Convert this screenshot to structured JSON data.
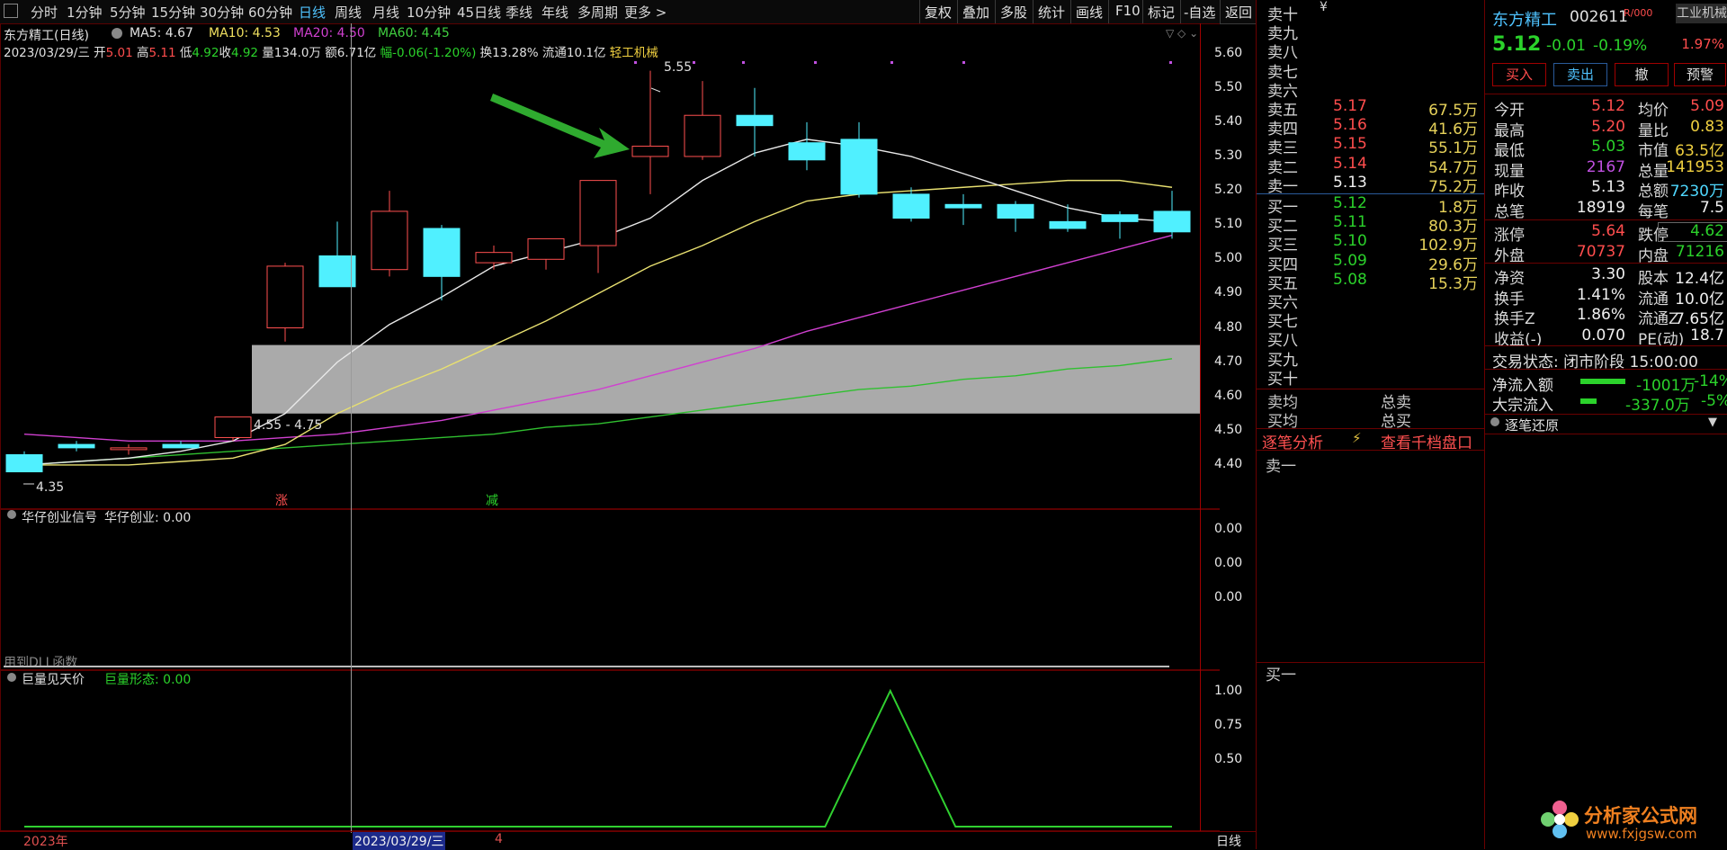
{
  "toolbar": {
    "periods": [
      "分时",
      "1分钟",
      "5分钟",
      "15分钟",
      "30分钟",
      "60分钟",
      "日线",
      "周线",
      "月线",
      "10分钟",
      "45日线",
      "季线",
      "年线",
      "多周期",
      "更多 >"
    ],
    "active_period": "日线",
    "right_buttons": [
      "复权",
      "叠加",
      "多股",
      "统计",
      "画线",
      "F10",
      "标记",
      "-自选",
      "返回"
    ]
  },
  "main_chart": {
    "title": "东方精工(日线)",
    "ma_legend": [
      {
        "label": "MA5: 4.67",
        "color": "#e0e0e0"
      },
      {
        "label": "MA10: 4.53",
        "color": "#f0e060"
      },
      {
        "label": "MA20: 4.50",
        "color": "#d040d0"
      },
      {
        "label": "MA60: 4.45",
        "color": "#40d040"
      }
    ],
    "info": {
      "date": "2023/03/29/三",
      "open_label": "开",
      "open": "5.01",
      "high_label": "高",
      "high": "5.11",
      "low_label": "低",
      "low": "4.92",
      "close_label": "收",
      "close": "4.92",
      "volume": "量134.0万",
      "amount": "额6.71亿",
      "change": "幅-0.06(-1.20%)",
      "turnover": "换13.28%",
      "float": "流通10.1亿",
      "industry": "轻工机械"
    },
    "y_ticks": [
      "5.60",
      "5.50",
      "5.40",
      "5.30",
      "5.20",
      "5.10",
      "5.00",
      "4.90",
      "4.80",
      "4.70",
      "4.60",
      "4.50",
      "4.40"
    ],
    "zone_label": "4.55 - 4.75",
    "high_mark": "5.55",
    "low_mark": "4.35",
    "marker_up": "涨",
    "marker_down": "减"
  },
  "chart_data": {
    "type": "candlestick",
    "ylim": [
      4.35,
      5.62
    ],
    "candles": [
      {
        "o": 4.43,
        "h": 4.44,
        "l": 4.38,
        "c": 4.38
      },
      {
        "o": 4.46,
        "h": 4.47,
        "l": 4.44,
        "c": 4.45
      },
      {
        "o": 4.45,
        "h": 4.46,
        "l": 4.43,
        "c": 4.45
      },
      {
        "o": 4.46,
        "h": 4.47,
        "l": 4.45,
        "c": 4.45
      },
      {
        "o": 4.48,
        "h": 4.52,
        "l": 4.47,
        "c": 4.54
      },
      {
        "o": 4.8,
        "h": 4.99,
        "l": 4.76,
        "c": 4.98
      },
      {
        "o": 5.01,
        "h": 5.11,
        "l": 4.92,
        "c": 4.92
      },
      {
        "o": 4.97,
        "h": 5.2,
        "l": 4.95,
        "c": 5.14
      },
      {
        "o": 5.09,
        "h": 5.1,
        "l": 4.88,
        "c": 4.95
      },
      {
        "o": 4.99,
        "h": 5.04,
        "l": 4.97,
        "c": 5.02
      },
      {
        "o": 5.0,
        "h": 5.06,
        "l": 4.97,
        "c": 5.06
      },
      {
        "o": 5.04,
        "h": 5.23,
        "l": 4.96,
        "c": 5.23
      },
      {
        "o": 5.3,
        "h": 5.55,
        "l": 5.19,
        "c": 5.33
      },
      {
        "o": 5.3,
        "h": 5.52,
        "l": 5.29,
        "c": 5.42
      },
      {
        "o": 5.42,
        "h": 5.5,
        "l": 5.3,
        "c": 5.39
      },
      {
        "o": 5.34,
        "h": 5.4,
        "l": 5.26,
        "c": 5.29
      },
      {
        "o": 5.35,
        "h": 5.4,
        "l": 5.18,
        "c": 5.19
      },
      {
        "o": 5.19,
        "h": 5.21,
        "l": 5.11,
        "c": 5.12
      },
      {
        "o": 5.16,
        "h": 5.19,
        "l": 5.1,
        "c": 5.15
      },
      {
        "o": 5.16,
        "h": 5.17,
        "l": 5.08,
        "c": 5.12
      },
      {
        "o": 5.11,
        "h": 5.16,
        "l": 5.08,
        "c": 5.09
      },
      {
        "o": 5.13,
        "h": 5.14,
        "l": 5.06,
        "c": 5.11
      },
      {
        "o": 5.14,
        "h": 5.2,
        "l": 5.06,
        "c": 5.08
      }
    ],
    "ma5": [
      4.4,
      4.41,
      4.42,
      4.44,
      4.47,
      4.55,
      4.7,
      4.81,
      4.89,
      4.98,
      5.02,
      5.06,
      5.12,
      5.23,
      5.31,
      5.35,
      5.33,
      5.3,
      5.25,
      5.2,
      5.15,
      5.12,
      5.11
    ],
    "ma10": [
      4.4,
      4.4,
      4.4,
      4.41,
      4.42,
      4.46,
      4.55,
      4.62,
      4.68,
      4.75,
      4.82,
      4.9,
      4.98,
      5.04,
      5.11,
      5.17,
      5.19,
      5.2,
      5.21,
      5.22,
      5.23,
      5.23,
      5.21
    ],
    "ma20": [
      4.49,
      4.48,
      4.47,
      4.47,
      4.47,
      4.48,
      4.49,
      4.51,
      4.53,
      4.56,
      4.59,
      4.62,
      4.66,
      4.7,
      4.74,
      4.79,
      4.83,
      4.87,
      4.91,
      4.95,
      4.99,
      5.03,
      5.07
    ],
    "ma60": [
      4.4,
      4.41,
      4.42,
      4.43,
      4.44,
      4.45,
      4.46,
      4.47,
      4.48,
      4.49,
      4.51,
      4.52,
      4.54,
      4.56,
      4.58,
      4.6,
      4.62,
      4.63,
      4.65,
      4.66,
      4.68,
      4.69,
      4.71
    ],
    "support_zone": [
      4.55,
      4.75
    ]
  },
  "ind1": {
    "title": "华仔创业信号",
    "value_label": "华仔创业: 0.00",
    "y_ticks": [
      "0.00",
      "0.00",
      "0.00"
    ],
    "footer": "用到DLL函数"
  },
  "ind2": {
    "title": "巨量见天价",
    "value_label": "巨量形态: 0.00",
    "y_ticks": [
      "1.00",
      "0.75",
      "0.50"
    ],
    "values": [
      0,
      0,
      0,
      0,
      0,
      0,
      0,
      0,
      0,
      0,
      0,
      0,
      0,
      0,
      0,
      0,
      0,
      0,
      0,
      0,
      0,
      0,
      0
    ],
    "peak_points": [
      [
        15.35,
        0
      ],
      [
        16.6,
        1
      ],
      [
        17.85,
        0
      ]
    ]
  },
  "xaxis": {
    "year": "2023年",
    "cursor_date": "2023/03/29/三",
    "next_label": "4",
    "period": "日线"
  },
  "orderbook": {
    "sells": [
      {
        "name": "卖十",
        "price": "",
        "vol": ""
      },
      {
        "name": "卖九",
        "price": "",
        "vol": ""
      },
      {
        "name": "卖八",
        "price": "",
        "vol": ""
      },
      {
        "name": "卖七",
        "price": "",
        "vol": ""
      },
      {
        "name": "卖六",
        "price": "",
        "vol": ""
      },
      {
        "name": "卖五",
        "price": "5.17",
        "vol": "67.5万"
      },
      {
        "name": "卖四",
        "price": "5.16",
        "vol": "41.6万"
      },
      {
        "name": "卖三",
        "price": "5.15",
        "vol": "55.1万"
      },
      {
        "name": "卖二",
        "price": "5.14",
        "vol": "54.7万"
      },
      {
        "name": "卖一",
        "price": "5.13",
        "vol": "75.2万"
      }
    ],
    "buys": [
      {
        "name": "买一",
        "price": "5.12",
        "vol": "1.8万"
      },
      {
        "name": "买二",
        "price": "5.11",
        "vol": "80.3万"
      },
      {
        "name": "买三",
        "price": "5.10",
        "vol": "102.9万"
      },
      {
        "name": "买四",
        "price": "5.09",
        "vol": "29.6万"
      },
      {
        "name": "买五",
        "price": "5.08",
        "vol": "15.3万"
      },
      {
        "name": "买六",
        "price": "",
        "vol": ""
      },
      {
        "name": "买七",
        "price": "",
        "vol": ""
      },
      {
        "name": "买八",
        "price": "",
        "vol": ""
      },
      {
        "name": "买九",
        "price": "",
        "vol": ""
      },
      {
        "name": "买十",
        "price": "",
        "vol": ""
      }
    ],
    "yen": "¥",
    "avg_sell": "卖均",
    "total_sell": "总卖",
    "avg_buy": "买均",
    "total_buy": "总买",
    "analysis_link": "逐笔分析",
    "depth_link": "查看千档盘口",
    "buy1_label": "卖一",
    "buy1_label2": "买一"
  },
  "quote": {
    "name": "东方精工",
    "code": "002611",
    "flag": "R/000",
    "industry": "工业机械",
    "industry_pct": "1.97%",
    "price": "5.12",
    "change": "-0.01",
    "change_pct": "-0.19%",
    "buttons": [
      "买入",
      "卖出",
      "撤",
      "预警"
    ],
    "rows1": [
      {
        "a": "今开",
        "b": "5.12",
        "bc": "red",
        "c": "均价",
        "d": "5.09",
        "dc": "red"
      },
      {
        "a": "最高",
        "b": "5.20",
        "bc": "red",
        "c": "量比",
        "d": "0.83",
        "dc": "yellow"
      },
      {
        "a": "最低",
        "b": "5.03",
        "bc": "green",
        "c": "市值",
        "d": "63.5亿",
        "dc": "yellow"
      },
      {
        "a": "现量",
        "b": "2167",
        "bc": "purple",
        "c": "总量",
        "d": "141953",
        "dc": "yellow"
      },
      {
        "a": "昨收",
        "b": "5.13",
        "bc": "white",
        "c": "总额",
        "d": "7230万",
        "dc": "cyan"
      },
      {
        "a": "总笔",
        "b": "18919",
        "bc": "white",
        "c": "每笔",
        "d": "7.5",
        "dc": "white"
      }
    ],
    "rows2": [
      {
        "a": "涨停",
        "b": "5.64",
        "bc": "red",
        "c": "跌停",
        "d": "4.62",
        "dc": "green"
      },
      {
        "a": "外盘",
        "b": "70737",
        "bc": "red",
        "c": "内盘",
        "d": "71216",
        "dc": "green"
      }
    ],
    "rows3": [
      {
        "a": "净资",
        "b": "3.30",
        "bc": "white",
        "c": "股本",
        "d": "12.4亿",
        "dc": "white"
      },
      {
        "a": "换手",
        "b": "1.41%",
        "bc": "white",
        "c": "流通",
        "d": "10.0亿",
        "dc": "white"
      },
      {
        "a": "换手Z",
        "b": "1.86%",
        "bc": "white",
        "c": "流通Z",
        "d": "7.65亿",
        "dc": "white"
      },
      {
        "a": "收益(-)",
        "b": "0.070",
        "bc": "white",
        "c": "PE(动)",
        "d": "18.7",
        "dc": "white"
      }
    ],
    "trade_status": "交易状态: 闭市阶段 15:00:00",
    "net_inflow_label": "净流入额",
    "net_inflow": "-1001万",
    "net_inflow_pct": "-14%",
    "bulk_inflow_label": "大宗流入",
    "bulk_inflow": "-337.0万",
    "bulk_inflow_pct": "-5%",
    "tick_restore": "逐笔还原"
  },
  "watermark": {
    "name": "分析家公式网",
    "url": "www.fxjgsw.com"
  }
}
